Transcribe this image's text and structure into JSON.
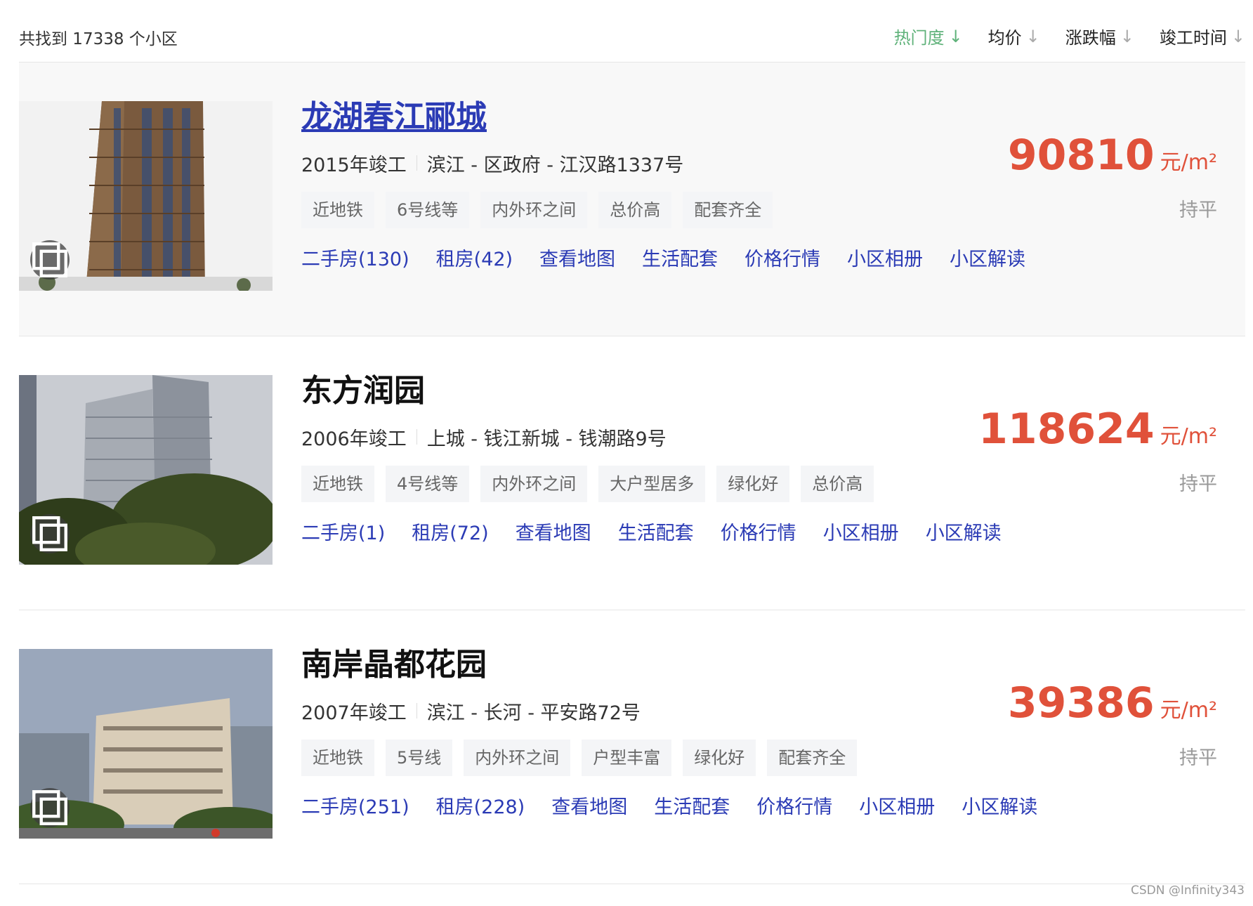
{
  "header": {
    "count_text": "共找到 17338 个小区",
    "sort": [
      {
        "label": "热门度",
        "arrow": "↓",
        "active": true
      },
      {
        "label": "均价",
        "arrow": "↓",
        "active": false
      },
      {
        "label": "涨跌幅",
        "arrow": "↓",
        "active": false
      },
      {
        "label": "竣工时间",
        "arrow": "↓",
        "active": false
      }
    ]
  },
  "communities": [
    {
      "name": "龙湖春江郦城",
      "year": "2015年竣工",
      "location": "滨江 - 区政府 - 江汉路1337号",
      "tags": [
        "近地铁",
        "6号线等",
        "内外环之间",
        "总价高",
        "配套齐全"
      ],
      "links": [
        "二手房(130)",
        "租房(42)",
        "查看地图",
        "生活配套",
        "价格行情",
        "小区相册",
        "小区解读"
      ],
      "price": "90810",
      "unit": "元/m²",
      "trend": "持平"
    },
    {
      "name": "东方润园",
      "year": "2006年竣工",
      "location": "上城 - 钱江新城 - 钱潮路9号",
      "tags": [
        "近地铁",
        "4号线等",
        "内外环之间",
        "大户型居多",
        "绿化好",
        "总价高"
      ],
      "links": [
        "二手房(1)",
        "租房(72)",
        "查看地图",
        "生活配套",
        "价格行情",
        "小区相册",
        "小区解读"
      ],
      "price": "118624",
      "unit": "元/m²",
      "trend": "持平"
    },
    {
      "name": "南岸晶都花园",
      "year": "2007年竣工",
      "location": "滨江 - 长河 - 平安路72号",
      "tags": [
        "近地铁",
        "5号线",
        "内外环之间",
        "户型丰富",
        "绿化好",
        "配套齐全"
      ],
      "links": [
        "二手房(251)",
        "租房(228)",
        "查看地图",
        "生活配套",
        "价格行情",
        "小区相册",
        "小区解读"
      ],
      "price": "39386",
      "unit": "元/m²",
      "trend": "持平"
    }
  ],
  "watermark": "CSDN @Infinity343"
}
